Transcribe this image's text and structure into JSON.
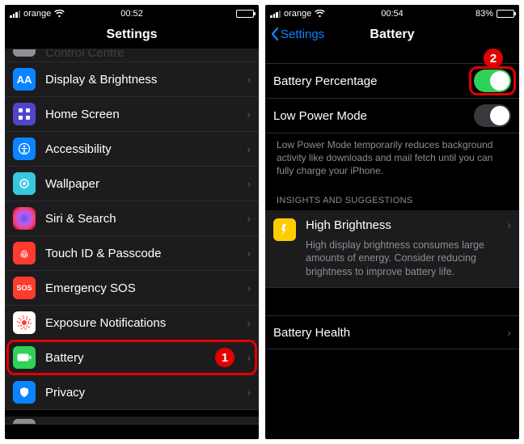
{
  "left": {
    "status": {
      "carrier": "orange",
      "time": "00:52"
    },
    "title": "Settings",
    "partial_top": "Control Centre",
    "items": [
      {
        "icon": "aa",
        "bg": "#0a84ff",
        "label": "Display & Brightness"
      },
      {
        "icon": "grid",
        "bg": "#5856d6",
        "label": "Home Screen"
      },
      {
        "icon": "access",
        "bg": "#0a84ff",
        "label": "Accessibility"
      },
      {
        "icon": "wallpaper",
        "bg": "#37c7de",
        "label": "Wallpaper"
      },
      {
        "icon": "siri",
        "bg": "#1c1c1e",
        "label": "Siri & Search"
      },
      {
        "icon": "touchid",
        "bg": "#ff3b30",
        "label": "Touch ID & Passcode"
      },
      {
        "icon": "sos",
        "bg": "#ff3b30",
        "label": "Emergency SOS"
      },
      {
        "icon": "exposure",
        "bg": "#ffffff",
        "label": "Exposure Notifications"
      },
      {
        "icon": "battery",
        "bg": "#30d158",
        "label": "Battery"
      },
      {
        "icon": "privacy",
        "bg": "#0a84ff",
        "label": "Privacy"
      }
    ],
    "highlight": {
      "index": 8,
      "badge": "1"
    }
  },
  "right": {
    "status": {
      "carrier": "orange",
      "time": "00:54",
      "battery_pct": "83%"
    },
    "back": "Settings",
    "title": "Battery",
    "rows": {
      "percentage": "Battery Percentage",
      "lowpower": "Low Power Mode"
    },
    "lowpower_footer": "Low Power Mode temporarily reduces background activity like downloads and mail fetch until you can fully charge your iPhone.",
    "insights_header": "INSIGHTS AND SUGGESTIONS",
    "insight": {
      "title": "High Brightness",
      "desc": "High display brightness consumes large amounts of energy. Consider reducing brightness to improve battery life."
    },
    "health": "Battery Health",
    "highlight": {
      "badge": "2"
    }
  },
  "colors": {
    "accent": "#0a84ff",
    "green": "#30d158",
    "red": "#e30000"
  }
}
